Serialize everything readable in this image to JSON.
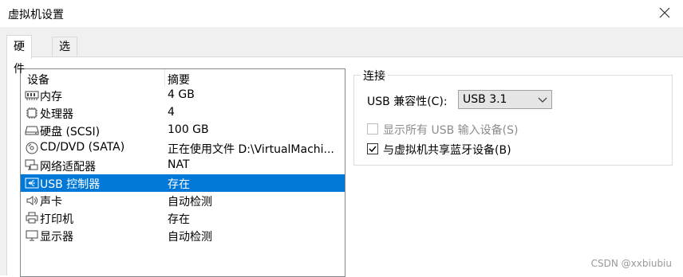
{
  "window": {
    "title": "虚拟机设置"
  },
  "tabs": [
    {
      "label": "硬件",
      "active": true
    },
    {
      "label": "选项",
      "active": false
    }
  ],
  "device_list": {
    "columns": {
      "device": "设备",
      "summary": "摘要"
    },
    "rows": [
      {
        "icon": "memory-icon",
        "device": "内存",
        "summary": "4 GB",
        "selected": false
      },
      {
        "icon": "processor-icon",
        "device": "处理器",
        "summary": "4",
        "selected": false
      },
      {
        "icon": "harddisk-icon",
        "device": "硬盘 (SCSI)",
        "summary": "100 GB",
        "selected": false
      },
      {
        "icon": "cdrom-icon",
        "device": "CD/DVD (SATA)",
        "summary": "正在使用文件 D:\\VirtualMachi...",
        "selected": false
      },
      {
        "icon": "network-adapter-icon",
        "device": "网络适配器",
        "summary": "NAT",
        "selected": false
      },
      {
        "icon": "usb-icon",
        "device": "USB 控制器",
        "summary": "存在",
        "selected": true
      },
      {
        "icon": "speaker-icon",
        "device": "声卡",
        "summary": "自动检测",
        "selected": false
      },
      {
        "icon": "printer-icon",
        "device": "打印机",
        "summary": "存在",
        "selected": false
      },
      {
        "icon": "monitor-icon",
        "device": "显示器",
        "summary": "自动检测",
        "selected": false
      }
    ]
  },
  "connection": {
    "group_label": "连接",
    "compat_label": "USB 兼容性(C):",
    "compat_value": "USB 3.1",
    "show_all_label": "显示所有 USB 输入设备(S)",
    "show_all_checked": false,
    "show_all_enabled": false,
    "share_bt_label": "与虚拟机共享蓝牙设备(B)",
    "share_bt_checked": true
  },
  "watermark": "CSDN @xxbiubiu",
  "colors": {
    "selection": "#0078d7",
    "disabled_text": "#8c8c8c"
  }
}
